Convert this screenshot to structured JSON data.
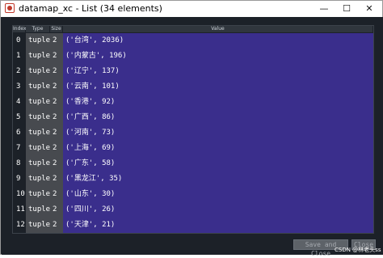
{
  "window": {
    "title": "datamap_xc - List (34 elements)",
    "minimize_glyph": "—",
    "maximize_glyph": "☐",
    "close_glyph": "✕"
  },
  "table": {
    "headers": {
      "index": "Index",
      "type": "Type",
      "size": "Size",
      "value": "Value"
    },
    "rows": [
      {
        "index": "0",
        "type": "tuple",
        "size": "2",
        "value": "('台湾', 2036)"
      },
      {
        "index": "1",
        "type": "tuple",
        "size": "2",
        "value": "('内蒙古', 196)"
      },
      {
        "index": "2",
        "type": "tuple",
        "size": "2",
        "value": "('辽宁', 137)"
      },
      {
        "index": "3",
        "type": "tuple",
        "size": "2",
        "value": "('云南', 101)"
      },
      {
        "index": "4",
        "type": "tuple",
        "size": "2",
        "value": "('香港', 92)"
      },
      {
        "index": "5",
        "type": "tuple",
        "size": "2",
        "value": "('广西', 86)"
      },
      {
        "index": "6",
        "type": "tuple",
        "size": "2",
        "value": "('河南', 73)"
      },
      {
        "index": "7",
        "type": "tuple",
        "size": "2",
        "value": "('上海', 69)"
      },
      {
        "index": "8",
        "type": "tuple",
        "size": "2",
        "value": "('广东', 58)"
      },
      {
        "index": "9",
        "type": "tuple",
        "size": "2",
        "value": "('黑龙江', 35)"
      },
      {
        "index": "10",
        "type": "tuple",
        "size": "2",
        "value": "('山东', 30)"
      },
      {
        "index": "11",
        "type": "tuple",
        "size": "2",
        "value": "('四川', 26)"
      },
      {
        "index": "12",
        "type": "tuple",
        "size": "2",
        "value": "('天津', 21)"
      }
    ]
  },
  "buttons": {
    "save_and_close": "Save and Close",
    "close": "Close"
  },
  "watermark": "CSDN @林老头ss",
  "colors": {
    "value_cell": "#3a2e8c",
    "type_cell": "#474a4f",
    "background": "#1c2128"
  }
}
